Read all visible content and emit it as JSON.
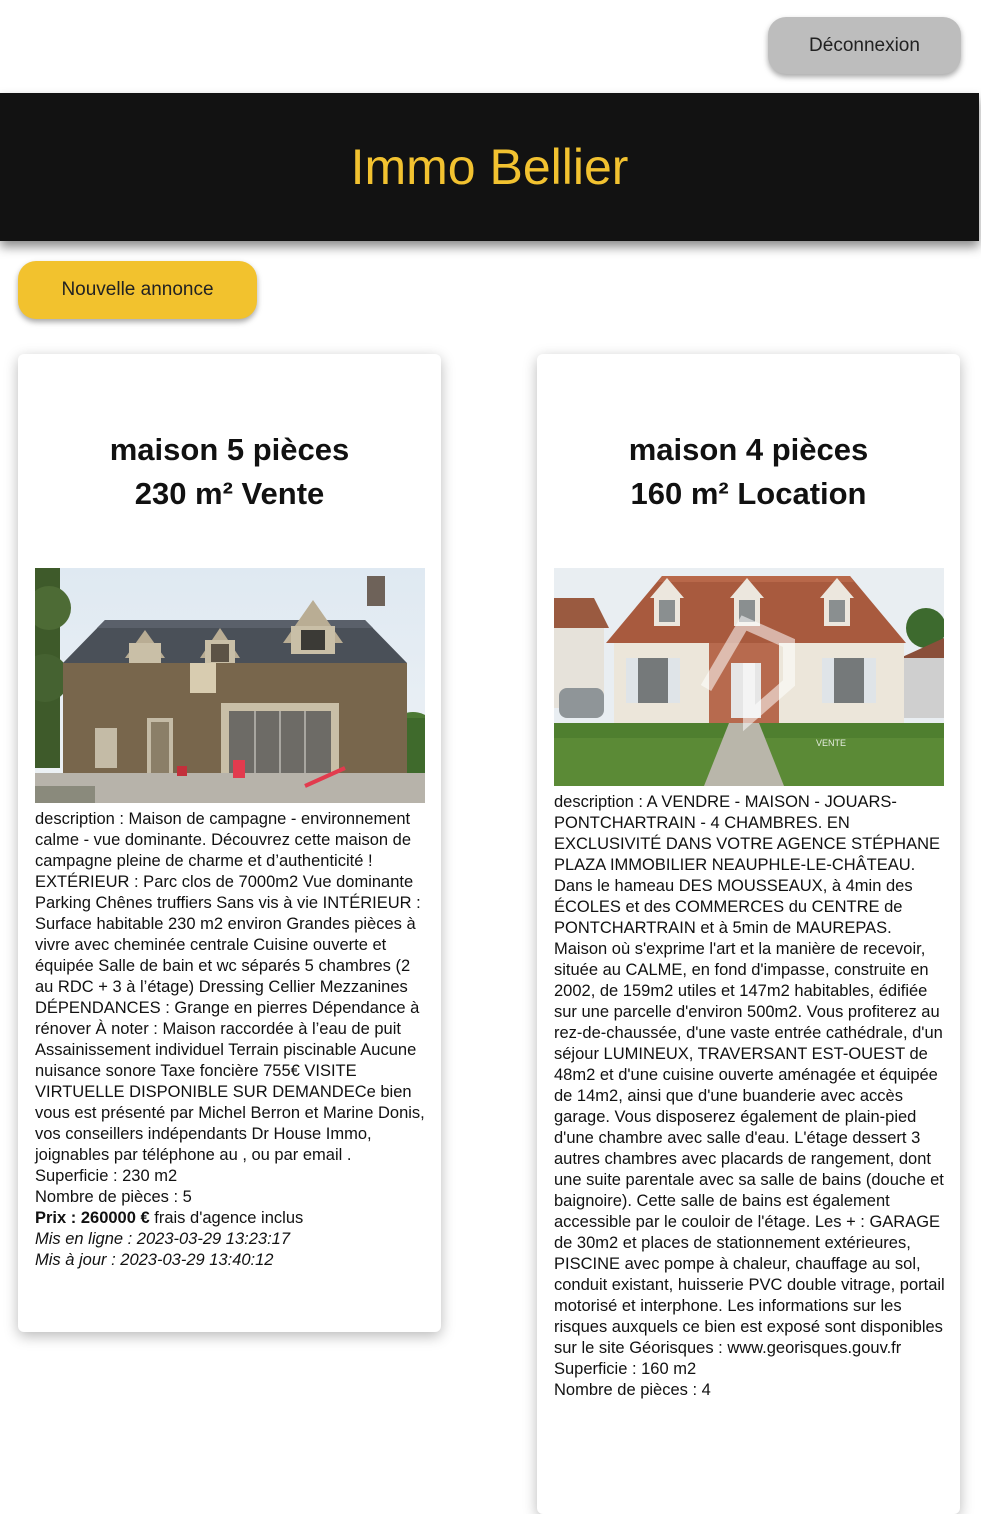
{
  "header": {
    "logout_label": "Déconnexion",
    "title": "Immo Bellier"
  },
  "actions": {
    "new_listing_label": "Nouvelle annonce"
  },
  "listings": [
    {
      "title_line1": "maison 5 pièces",
      "title_line2": "230 m² Vente",
      "description": "description : Maison de campagne - environnement calme - vue dominante. Découvrez cette maison de campagne pleine de charme et d’authenticité ! EXTÉRIEUR : Parc clos de 7000m2 Vue dominante Parking Chênes truffiers Sans vis à vie INTÉRIEUR : Surface habitable 230 m2 environ Grandes pièces à vivre avec cheminée centrale Cuisine ouverte et équipée Salle de bain et wc séparés 5 chambres (2 au RDC + 3 à l’étage) Dressing Cellier Mezzanines DÉPENDANCES : Grange en pierres Dépendance à rénover À noter : Maison raccordée à l’eau de puit Assainissement individuel Terrain piscinable Aucune nuisance sonore Taxe foncière 755€ VISITE VIRTUELLE DISPONIBLE SUR DEMANDECe bien vous est présenté par Michel Berron et Marine Donis, vos conseillers indépendants Dr House Immo, joignables par téléphone au , ou par email .",
      "superficie": "Superficie : 230 m2",
      "pieces": "Nombre de pièces : 5",
      "price_bold": "Prix : 260000 €",
      "price_suffix": " frais d'agence inclus",
      "online": "Mis en ligne : 2023-03-29 13:23:17",
      "updated": "Mis à jour : 2023-03-29 13:40:12"
    },
    {
      "title_line1": "maison 4 pièces",
      "title_line2": "160 m² Location",
      "photo_watermark": "VENTE",
      "description": "description : A VENDRE - MAISON - JOUARS-PONTCHARTRAIN - 4 CHAMBRES. EN EXCLUSIVITÉ DANS VOTRE AGENCE STÉPHANE PLAZA IMMOBILIER NEAUPHLE-LE-CHÂTEAU. Dans le hameau DES MOUSSEAUX, à 4min des ÉCOLES et des COMMERCES du CENTRE de PONTCHARTRAIN et à 5min de MAUREPAS. Maison où s'exprime l'art et la manière de recevoir, située au CALME, en fond d'impasse, construite en 2002, de 159m2 utiles et 147m2 habitables, édifiée sur une parcelle d'environ 500m2. Vous profiterez au rez-de-chaussée, d'une vaste entrée cathédrale, d'un séjour LUMINEUX, TRAVERSANT EST-OUEST de 48m2 et d'une cuisine ouverte aménagée et équipée de 14m2, ainsi que d'une buanderie avec accès garage. Vous disposerez également de plain-pied d'une chambre avec salle d'eau. L'étage dessert 3 autres chambres avec placards de rangement, dont une suite parentale avec sa salle de bains (douche et baignoire). Cette salle de bains est également accessible par le couloir de l'étage. Les + : GARAGE de 30m2 et places de stationnement extérieures, PISCINE avec pompe à chaleur, chauffage au sol, conduit existant, huisserie PVC double vitrage, portail motorisé et interphone. Les informations sur les risques auxquels ce bien est exposé sont disponibles sur le site Géorisques : www.georisques.gouv.fr",
      "superficie": "Superficie : 160 m2",
      "pieces": "Nombre de pièces : 4"
    }
  ]
}
